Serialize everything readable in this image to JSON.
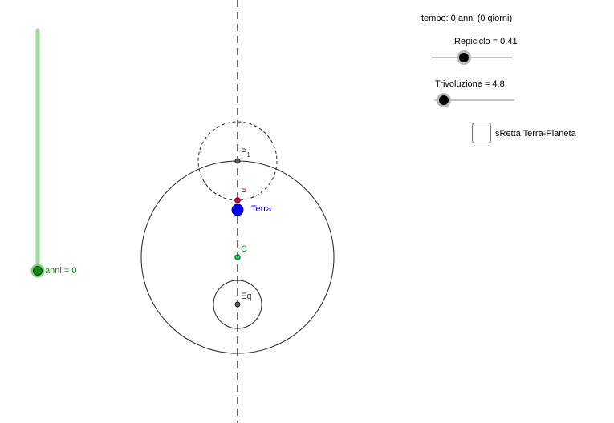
{
  "colors": {
    "earth": "#0000ff",
    "planet": "#cc0044",
    "center": "#10a040",
    "slider_anni": "#118811",
    "slider_anni_track": "#99dd99",
    "point_dark": "#333333"
  },
  "info": {
    "tempo": "tempo: 0 anni   (0 giorni)"
  },
  "sliders": {
    "epicycle": {
      "label": "Repiciclo = 0.41",
      "value": 0.41
    },
    "revolution": {
      "label": "Trivoluzione = 4.8",
      "value": 4.8
    },
    "years": {
      "label": "anni = 0",
      "value": 0
    }
  },
  "checkbox": {
    "label": "sRetta Terra-Pianeta",
    "checked": false
  },
  "points": {
    "p1": "P",
    "p1_sub": "1",
    "p": "P",
    "earth": "Terra",
    "center": "C",
    "equant": "Eq"
  }
}
